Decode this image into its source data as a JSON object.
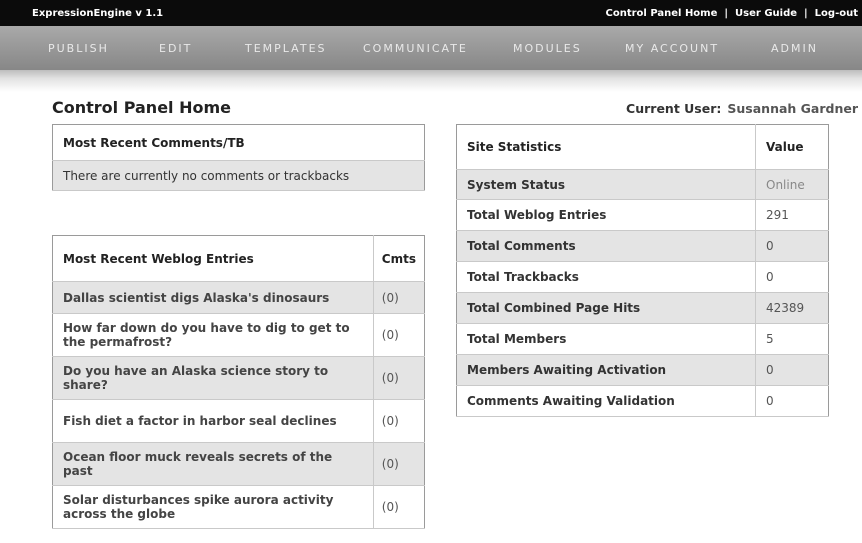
{
  "topbar": {
    "app_name": "ExpressionEngine  v 1.1",
    "links": [
      "Control Panel Home",
      "User Guide",
      "Log-out"
    ],
    "separator": "|"
  },
  "nav": [
    "PUBLISH",
    "EDIT",
    "TEMPLATES",
    "COMMUNICATE",
    "MODULES",
    "MY ACCOUNT",
    "ADMIN"
  ],
  "page": {
    "title": "Control Panel Home",
    "current_user_label": "Current User:",
    "current_user": "Susannah Gardner"
  },
  "recent_comments": {
    "header": "Most Recent Comments/TB",
    "empty_text": "There are currently no comments or trackbacks"
  },
  "recent_entries": {
    "header": "Most Recent Weblog Entries",
    "count_header": "Cmts",
    "rows": [
      {
        "title": "Dallas scientist digs Alaska's dinosaurs",
        "count": "(0)"
      },
      {
        "title": "How far down do you have to dig to get to the permafrost?",
        "count": "(0)"
      },
      {
        "title": "Do you have an Alaska science story to share?",
        "count": "(0)"
      },
      {
        "title": "Fish diet a factor in harbor seal declines",
        "count": "(0)"
      },
      {
        "title": "Ocean floor muck reveals secrets of the past",
        "count": "(0)"
      },
      {
        "title": "Solar disturbances spike aurora activity across the globe",
        "count": "(0)"
      }
    ]
  },
  "site_stats": {
    "header_label": "Site Statistics",
    "header_value": "Value",
    "rows": [
      {
        "label": "System Status",
        "value": "Online"
      },
      {
        "label": "Total Weblog Entries",
        "value": "291"
      },
      {
        "label": "Total Comments",
        "value": "0"
      },
      {
        "label": "Total Trackbacks",
        "value": "0"
      },
      {
        "label": "Total Combined Page Hits",
        "value": "42389"
      },
      {
        "label": "Total Members",
        "value": "5"
      },
      {
        "label": "Members Awaiting Activation",
        "value": "0"
      },
      {
        "label": "Comments Awaiting Validation",
        "value": "0"
      }
    ]
  }
}
